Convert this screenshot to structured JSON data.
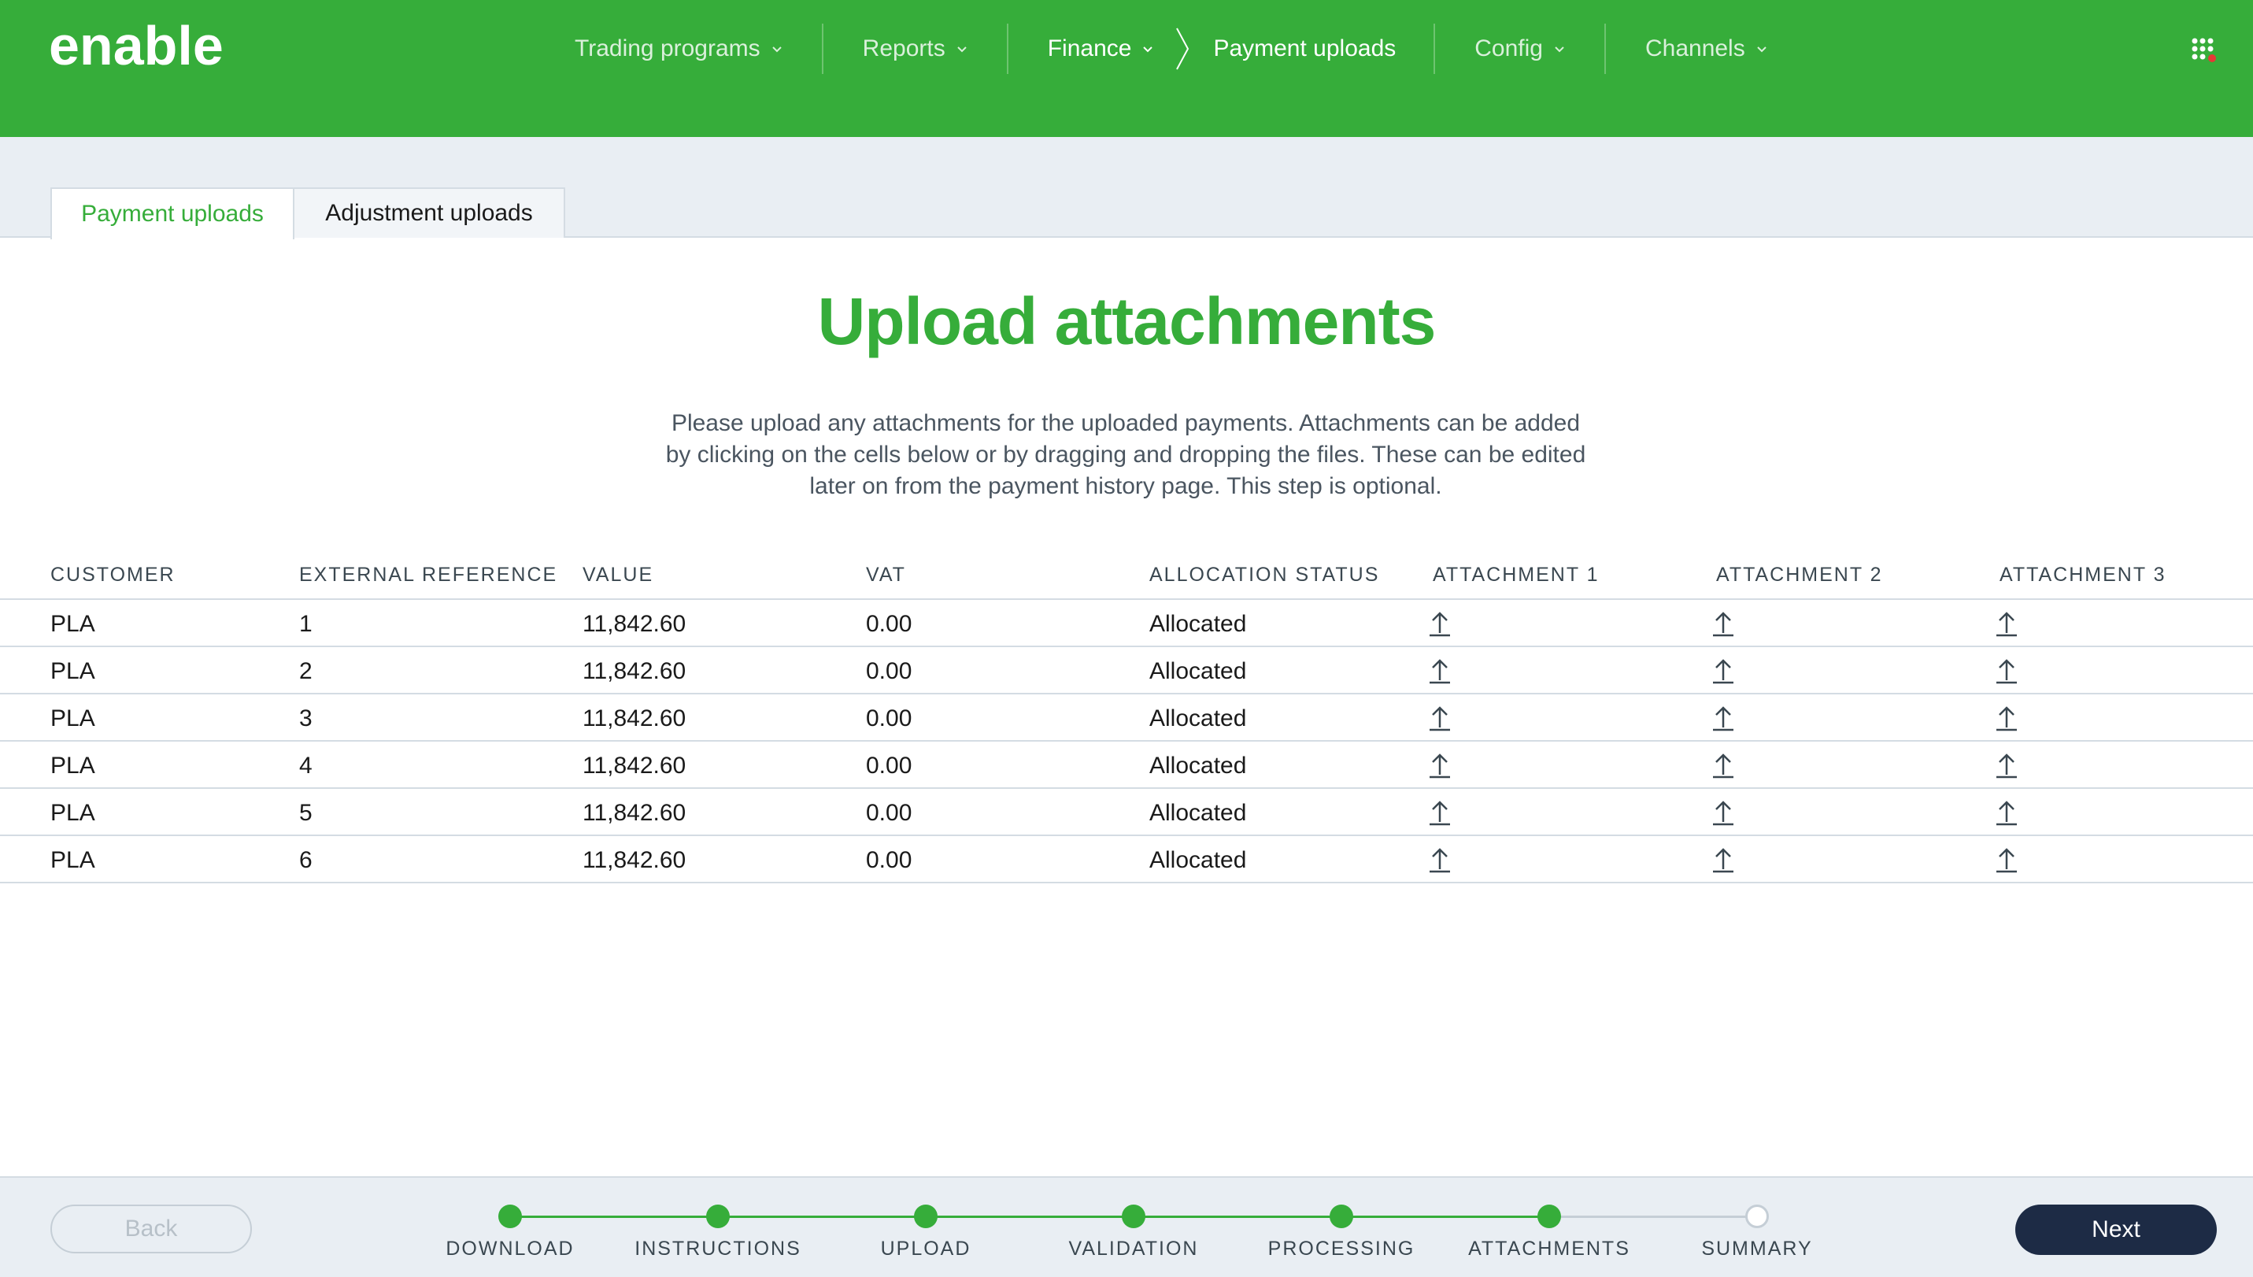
{
  "app": {
    "logo_text": "enable",
    "colors": {
      "brand": "#36ad3a",
      "primary_button": "#1d2b45",
      "notification_dot": "#e53935"
    }
  },
  "nav": {
    "items": [
      {
        "label": "Trading programs"
      },
      {
        "label": "Reports"
      },
      {
        "label": "Finance"
      },
      {
        "label": "Config"
      },
      {
        "label": "Channels"
      }
    ],
    "current_page": "Payment uploads",
    "apps_icon": "grid-icon"
  },
  "tabs": [
    {
      "label": "Payment uploads",
      "active": true
    },
    {
      "label": "Adjustment uploads",
      "active": false
    }
  ],
  "main": {
    "title": "Upload attachments",
    "description": "Please upload any attachments for the uploaded payments. Attachments can be added by clicking on the cells below or by dragging and dropping the files. These can be edited later on from the payment history page. This step is optional."
  },
  "table": {
    "columns": [
      "CUSTOMER",
      "EXTERNAL REFERENCE",
      "VALUE",
      "VAT",
      "ALLOCATION STATUS",
      "ATTACHMENT 1",
      "ATTACHMENT 2",
      "ATTACHMENT 3"
    ],
    "rows": [
      {
        "customer": "PLA",
        "external_reference": "1",
        "value": "11,842.60",
        "vat": "0.00",
        "allocation_status": "Allocated"
      },
      {
        "customer": "PLA",
        "external_reference": "2",
        "value": "11,842.60",
        "vat": "0.00",
        "allocation_status": "Allocated"
      },
      {
        "customer": "PLA",
        "external_reference": "3",
        "value": "11,842.60",
        "vat": "0.00",
        "allocation_status": "Allocated"
      },
      {
        "customer": "PLA",
        "external_reference": "4",
        "value": "11,842.60",
        "vat": "0.00",
        "allocation_status": "Allocated"
      },
      {
        "customer": "PLA",
        "external_reference": "5",
        "value": "11,842.60",
        "vat": "0.00",
        "allocation_status": "Allocated"
      },
      {
        "customer": "PLA",
        "external_reference": "6",
        "value": "11,842.60",
        "vat": "0.00",
        "allocation_status": "Allocated"
      }
    ],
    "attachment_icon": "upload-icon"
  },
  "footer": {
    "back_label": "Back",
    "next_label": "Next",
    "steps": [
      {
        "label": "DOWNLOAD",
        "status": "complete"
      },
      {
        "label": "INSTRUCTIONS",
        "status": "complete"
      },
      {
        "label": "UPLOAD",
        "status": "complete"
      },
      {
        "label": "VALIDATION",
        "status": "complete"
      },
      {
        "label": "PROCESSING",
        "status": "complete"
      },
      {
        "label": "ATTACHMENTS",
        "status": "current"
      },
      {
        "label": "SUMMARY",
        "status": "pending"
      }
    ]
  }
}
